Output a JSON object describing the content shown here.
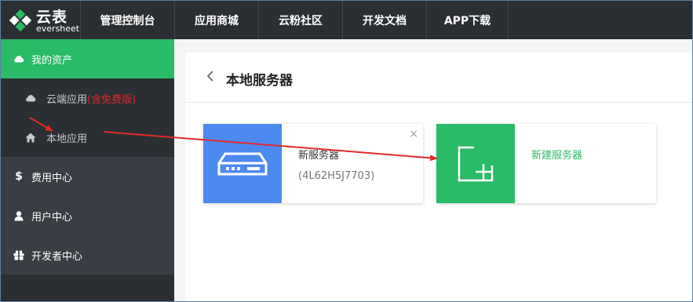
{
  "brand": {
    "name_cn": "云表",
    "name_en": "eversheet"
  },
  "nav": [
    {
      "label": "管理控制台",
      "width": 120
    },
    {
      "label": "应用商城",
      "width": 107
    },
    {
      "label": "云粉社区",
      "width": 107
    },
    {
      "label": "开发文档",
      "width": 107
    },
    {
      "label": "APP下载",
      "width": 105
    }
  ],
  "sidebar": {
    "my_assets": "我的资产",
    "cloud_app": "云端应用",
    "cloud_app_note": "(含免费版)",
    "local_app": "本地应用",
    "billing": "费用中心",
    "user_center": "用户中心",
    "dev_center": "开发者中心"
  },
  "page": {
    "title": "本地服务器"
  },
  "server_card": {
    "name": "新服务器",
    "id": "(4L62H5J7703)",
    "close": "×"
  },
  "new_server": {
    "label": "新建服务器"
  },
  "colors": {
    "accent": "#2abb67",
    "blue": "#4d8af0",
    "annotation": "#e12a2a"
  }
}
